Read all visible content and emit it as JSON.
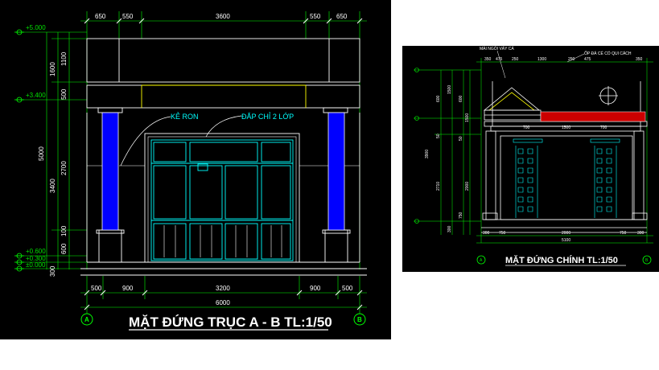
{
  "left_drawing": {
    "title": "MẶT ĐỨNG TRỤC A - B TL:1/50",
    "top_dims": [
      "650",
      "550",
      "3600",
      "550",
      "650"
    ],
    "bottom_dims": [
      "500",
      "900",
      "3200",
      "900",
      "500"
    ],
    "overall_width": "6000",
    "left_dims": [
      "1100",
      "1600",
      "500",
      "5000",
      "2700",
      "3400",
      "100",
      "600",
      "300"
    ],
    "levels": [
      "+5.000",
      "+3.400",
      "+0.600",
      "+0.300",
      "±0.000"
    ],
    "annotations": {
      "ke_ron": "KẺ RON",
      "dap_chi": "ĐẮP CHỈ 2 LỚP"
    },
    "axis_labels": [
      "A",
      "B"
    ]
  },
  "right_drawing": {
    "title": "MẶT ĐỨNG CHÍNH TL:1/50",
    "annotations": {
      "left": "MÁI NGÓI VẨY CÁ",
      "right": "ỐP ĐÁ CỂ CỔ QUI CÁCH"
    },
    "top_dims": [
      "350",
      "475",
      "250",
      "1300",
      "250",
      "475",
      "350"
    ],
    "mid_dims": [
      "700",
      "1500",
      "700"
    ],
    "bottom_dims": [
      "300",
      "750",
      "2000",
      "750",
      "300"
    ],
    "overall_width": "5100",
    "left_dims": [
      "600",
      "1500",
      "50",
      "3900",
      "2710",
      "300"
    ],
    "inner_dims": [
      "600",
      "1500",
      "50",
      "2000",
      "750"
    ],
    "axis_labels": [
      "A",
      "B"
    ]
  },
  "colors": {
    "cad_background": "#000000",
    "column_fill": "#0000ff",
    "outline": "#ffffff",
    "dimension_green": "#00ff00",
    "cyan": "#00ffff",
    "yellow": "#ffff00"
  }
}
